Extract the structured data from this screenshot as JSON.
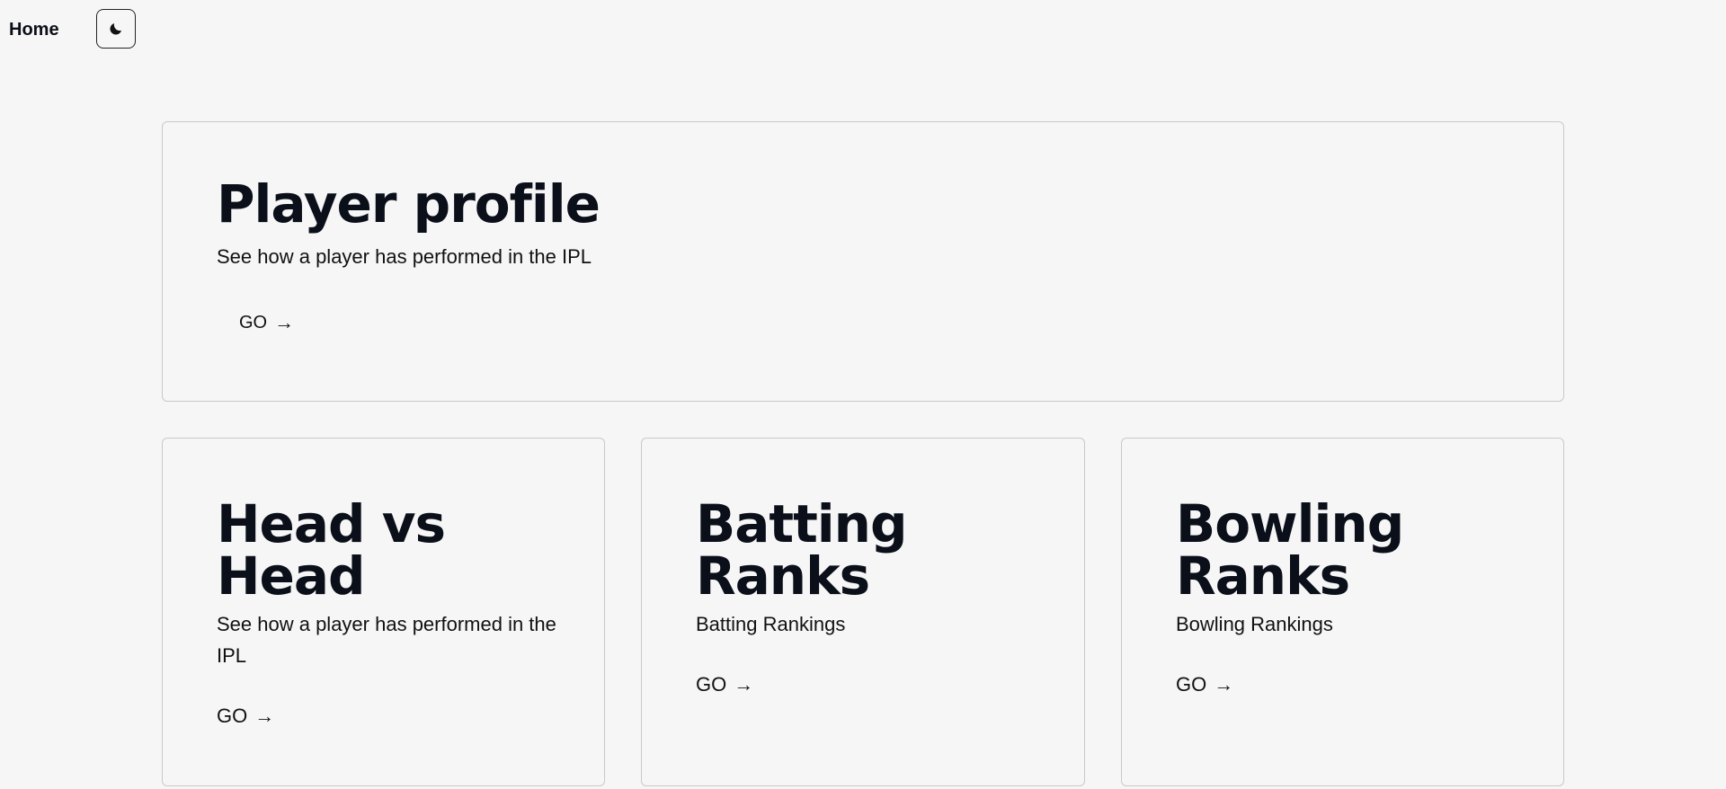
{
  "nav": {
    "home_label": "Home",
    "theme_toggle_icon": "moon-icon"
  },
  "cards": {
    "player_profile": {
      "title": "Player profile",
      "description": "See how a player has performed in the IPL",
      "go_label": "GO",
      "arrow": "→"
    },
    "head_vs_head": {
      "title_line1": "Head vs",
      "title_line2": "Head",
      "description": "See how a player has performed in the IPL",
      "go_label": "GO",
      "arrow": "→"
    },
    "batting_ranks": {
      "title_line1": "Batting",
      "title_line2": "Ranks",
      "description": "Batting Rankings",
      "go_label": "GO",
      "arrow": "→"
    },
    "bowling_ranks": {
      "title_line1": "Bowling",
      "title_line2": "Ranks",
      "description": "Bowling Rankings",
      "go_label": "GO",
      "arrow": "→"
    }
  }
}
